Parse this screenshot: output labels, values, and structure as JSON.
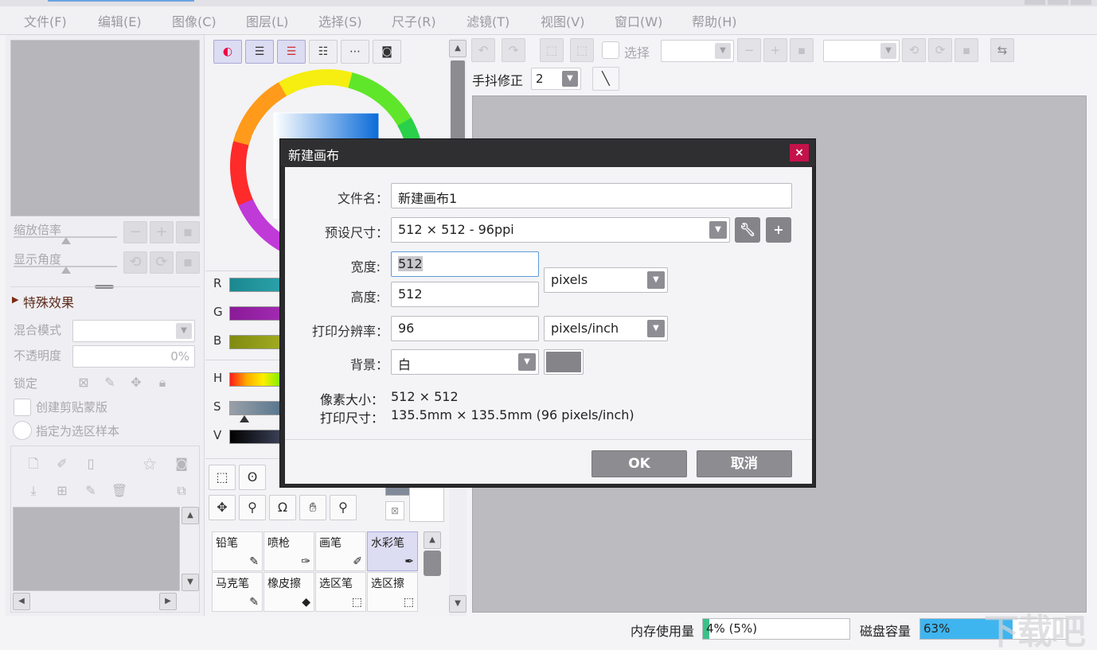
{
  "menu": {
    "items": [
      "文件(F)",
      "编辑(E)",
      "图像(C)",
      "图层(L)",
      "选择(S)",
      "尺子(R)",
      "滤镜(T)",
      "视图(V)",
      "窗口(W)",
      "帮助(H)"
    ]
  },
  "nav": {
    "zoom_label": "缩放倍率",
    "angle_label": "显示角度"
  },
  "layer": {
    "effects_label": "特殊效果",
    "blend_label": "混合模式",
    "opacity_label": "不透明度",
    "opacity_value": "0%",
    "lock_label": "锁定",
    "clip_label": "创建剪贴蒙版",
    "selsrc_label": "指定为选区样本"
  },
  "color": {
    "r_label": "R",
    "g_label": "G",
    "b_label": "B",
    "h_label": "H",
    "s_label": "S",
    "v_label": "V"
  },
  "brushes": [
    {
      "label": "铅笔",
      "icon": "pencil-icon"
    },
    {
      "label": "喷枪",
      "icon": "airbrush-icon"
    },
    {
      "label": "画笔",
      "icon": "brush-icon"
    },
    {
      "label": "水彩笔",
      "icon": "watercolor-icon"
    },
    {
      "label": "马克笔",
      "icon": "marker-icon"
    },
    {
      "label": "橡皮擦",
      "icon": "eraser-icon"
    },
    {
      "label": "选区笔",
      "icon": "selpen-icon"
    },
    {
      "label": "选区擦",
      "icon": "selerase-icon"
    }
  ],
  "toolbar": {
    "select_label": "选择",
    "stabilizer_label": "手抖修正",
    "stabilizer_value": "2"
  },
  "status": {
    "memory_label": "内存使用量",
    "memory_value": "4% (5%)",
    "memory_fraction": 0.04,
    "disk_label": "磁盘容量",
    "disk_value": "63%",
    "disk_fraction": 0.63,
    "memory_color": "#3cc08a",
    "disk_color": "#3fb5ef"
  },
  "dialog": {
    "title": "新建画布",
    "filename_label": "文件名：",
    "filename_value": "新建画布1",
    "preset_label": "预设尺寸：",
    "preset_value": "512 × 512 - 96ppi",
    "width_label": "宽度:",
    "width_value": "512",
    "height_label": "高度:",
    "height_value": "512",
    "unit_value": "pixels",
    "resolution_label": "打印分辨率：",
    "resolution_value": "96",
    "res_unit_value": "pixels/inch",
    "background_label": "背景：",
    "background_value": "白",
    "background_swatch_color": "#858489",
    "pixel_size_label": "像素大小：",
    "pixel_size_value": "512 × 512",
    "print_size_label": "打印尺寸：",
    "print_size_value": "135.5mm × 135.5mm (96 pixels/inch)",
    "ok_label": "OK",
    "cancel_label": "取消",
    "close_glyph": "×"
  },
  "watermark": "下载吧"
}
